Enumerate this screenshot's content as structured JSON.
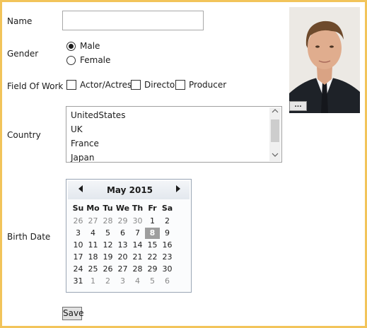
{
  "form": {
    "name_label": "Name",
    "name_value": "",
    "gender_label": "Gender",
    "gender_options": [
      {
        "label": "Male",
        "checked": true
      },
      {
        "label": "Female",
        "checked": false
      }
    ],
    "field_of_work_label": "Field Of Work",
    "field_of_work_options": [
      {
        "label": "Actor/Actress",
        "checked": false
      },
      {
        "label": "Director",
        "checked": false
      },
      {
        "label": "Producer",
        "checked": false
      }
    ],
    "country_label": "Country",
    "country_options": [
      "UnitedStates",
      "UK",
      "France",
      "Japan"
    ],
    "birth_date_label": "Birth Date",
    "photo_browse_label": "...",
    "save_label": "Save"
  },
  "calendar": {
    "month_title": "May 2015",
    "prev_icon": "triangle-left-icon",
    "next_icon": "triangle-right-icon",
    "weekdays": [
      "Su",
      "Mo",
      "Tu",
      "We",
      "Th",
      "Fr",
      "Sa"
    ],
    "weeks": [
      [
        "26",
        "27",
        "28",
        "29",
        "30",
        "1",
        "2"
      ],
      [
        "3",
        "4",
        "5",
        "6",
        "7",
        "8",
        "9"
      ],
      [
        "10",
        "11",
        "12",
        "13",
        "14",
        "15",
        "16"
      ],
      [
        "17",
        "18",
        "19",
        "20",
        "21",
        "22",
        "23"
      ],
      [
        "24",
        "25",
        "26",
        "27",
        "28",
        "29",
        "30"
      ],
      [
        "31",
        "1",
        "2",
        "3",
        "4",
        "5",
        "6"
      ]
    ],
    "selected_day": "8"
  },
  "colors": {
    "window_border": "#f2c45a",
    "selected_day_bg": "#9e9e9e"
  }
}
